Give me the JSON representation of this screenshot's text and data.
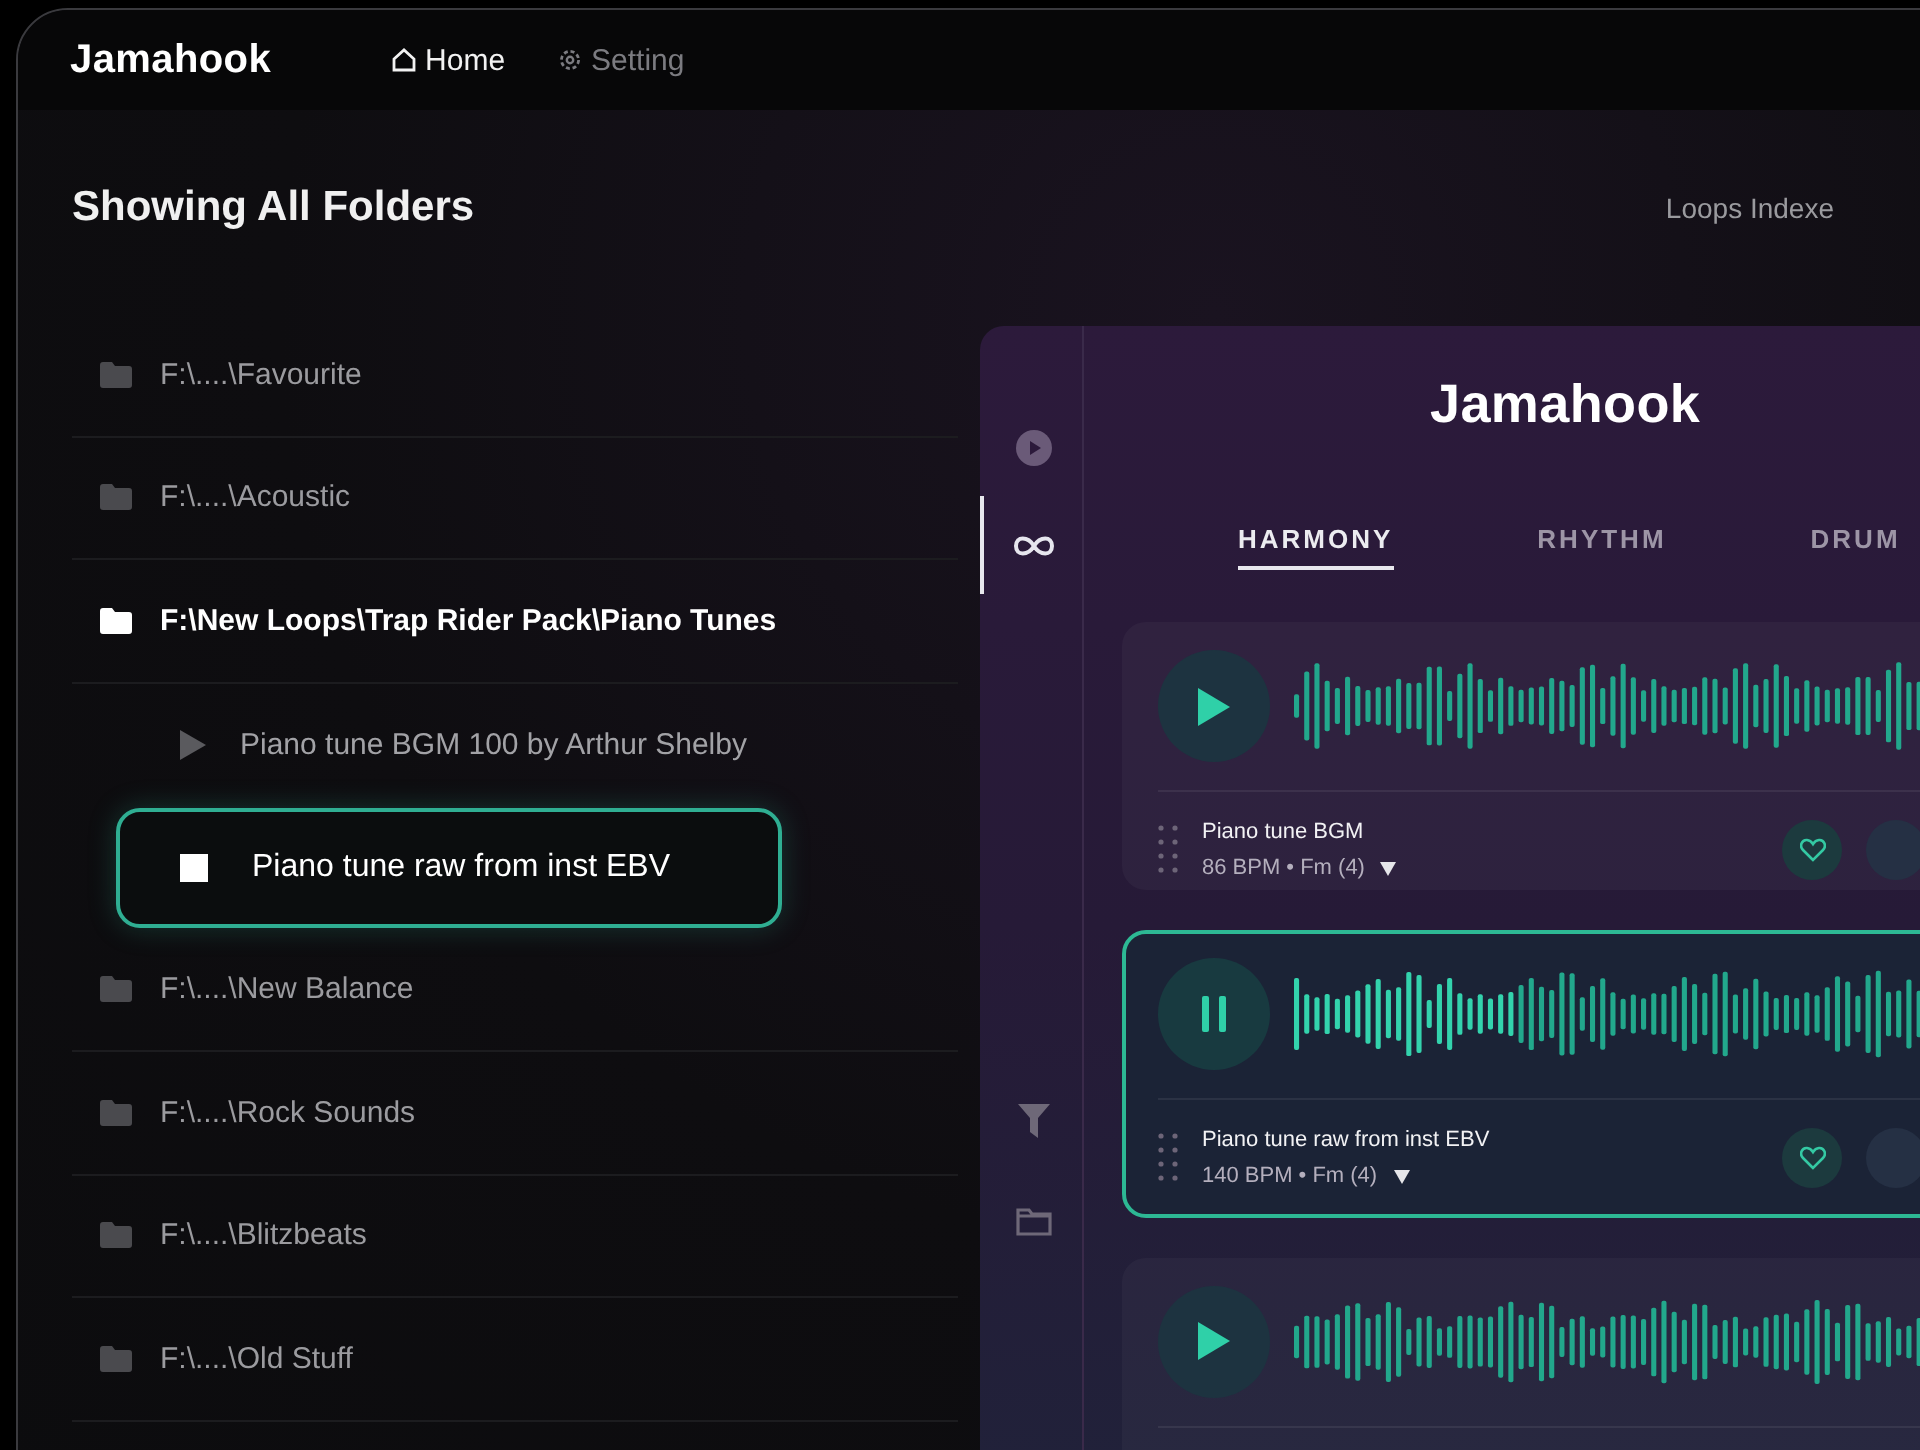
{
  "app": {
    "logo": "Jamahook"
  },
  "nav": [
    {
      "label": "Home",
      "kind": "home",
      "selected": true
    },
    {
      "label": "Setting",
      "kind": "gear",
      "selected": false
    }
  ],
  "header": {
    "title": "Showing All Folders",
    "loops_indexed": "Loops Indexe"
  },
  "folders": [
    {
      "path": "F:\\....\\Favourite",
      "expanded": false
    },
    {
      "path": "F:\\....\\Acoustic",
      "expanded": false
    },
    {
      "path": "F:\\New Loops\\Trap Rider Pack\\Piano Tunes",
      "expanded": true,
      "children": [
        {
          "name": "Piano tune BGM 100 by Arthur Shelby",
          "selected": false
        },
        {
          "name": "Piano tune raw from inst EBV",
          "selected": true
        }
      ]
    },
    {
      "path": "F:\\....\\New Balance",
      "expanded": false
    },
    {
      "path": "F:\\....\\Rock Sounds",
      "expanded": false
    },
    {
      "path": "F:\\....\\Blitzbeats",
      "expanded": false
    },
    {
      "path": "F:\\....\\Old Stuff",
      "expanded": false
    }
  ],
  "plugin": {
    "logo": "Jamahook",
    "rail": [
      {
        "kind": "play",
        "selected": false
      },
      {
        "kind": "loop",
        "selected": true
      },
      {
        "kind": "filter",
        "selected": false
      },
      {
        "kind": "folder",
        "selected": false
      }
    ],
    "tabs": [
      {
        "label": "HARMONY",
        "selected": true
      },
      {
        "label": "RHYTHM",
        "selected": false
      },
      {
        "label": "DRUM",
        "selected": false
      }
    ],
    "loops": [
      {
        "name": "Piano tune BGM",
        "info": "86 BPM • Fm (4)",
        "playing": false,
        "selected": false
      },
      {
        "name": "Piano tune raw from inst EBV",
        "info": "140 BPM • Fm (4)",
        "playing": true,
        "selected": true
      },
      {
        "playing": false,
        "selected": false
      }
    ]
  }
}
